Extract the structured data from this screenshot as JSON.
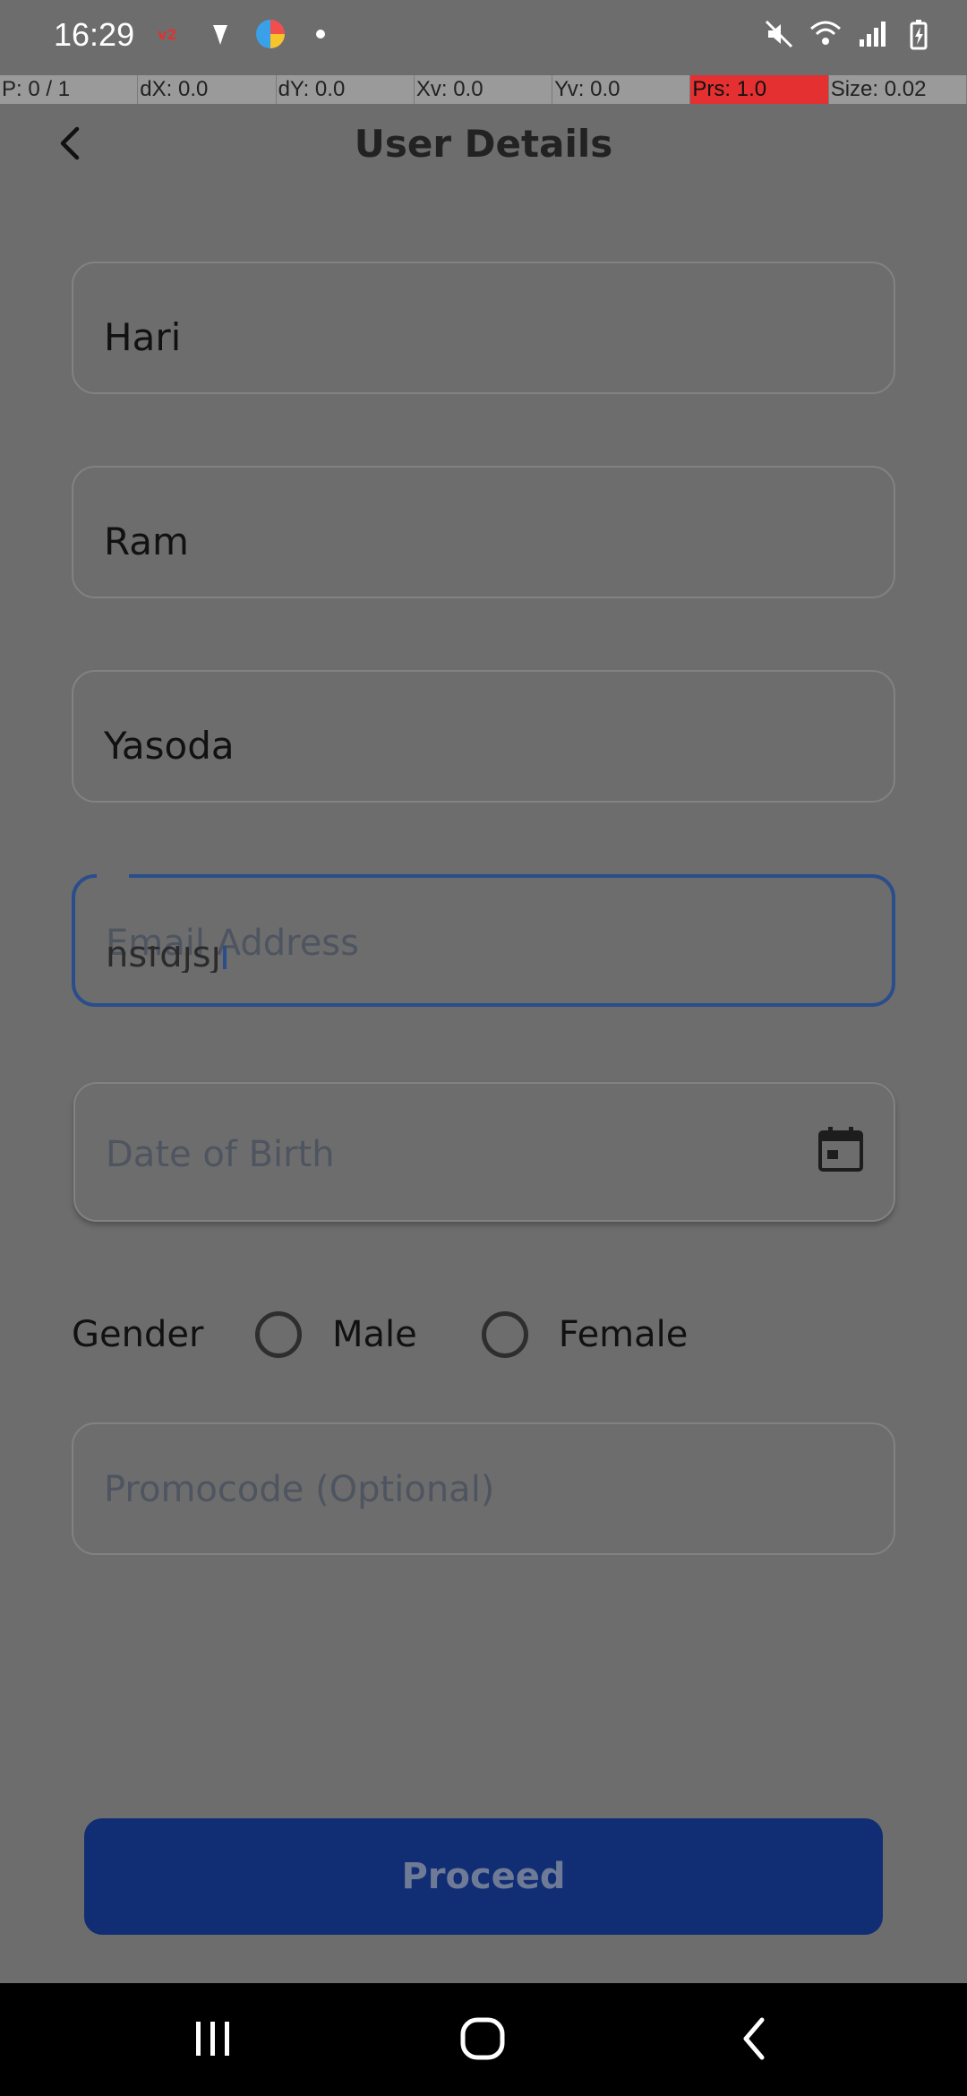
{
  "status_bar": {
    "time": "16:29",
    "left_icons": [
      "notification-icon",
      "vpn-icon",
      "browser-icon",
      "dot-icon"
    ],
    "right_icons": [
      "mute-icon",
      "wifi-icon",
      "signal-icon",
      "battery-icon"
    ]
  },
  "pointer_overlay": {
    "cells": [
      "P: 0 / 1",
      "dX: 0.0",
      "dY: 0.0",
      "Xv: 0.0",
      "Yv: 0.0",
      "Prs: 1.0",
      "Size: 0.02"
    ],
    "pressure_color": "#e43030"
  },
  "header": {
    "title": "User Details"
  },
  "form": {
    "first_name": "Hari",
    "middle_name": "Ram",
    "last_name": "Yasoda",
    "email": {
      "placeholder": "Email Address",
      "typed_text": "nsfdjsj"
    },
    "dob": {
      "placeholder": "Date of Birth",
      "icon": "calendar-icon"
    },
    "gender": {
      "label": "Gender",
      "options": [
        {
          "label": "Male",
          "selected": false
        },
        {
          "label": "Female",
          "selected": false
        }
      ]
    },
    "promocode": {
      "placeholder": "Promocode (Optional)"
    }
  },
  "proceed_label": "Proceed",
  "colors": {
    "overlay": "#6d6d6d",
    "focus_border": "#2a4e8c",
    "button": "#112d74"
  },
  "nav_bar": {
    "buttons": [
      "recents-icon",
      "home-icon",
      "back-icon"
    ]
  }
}
